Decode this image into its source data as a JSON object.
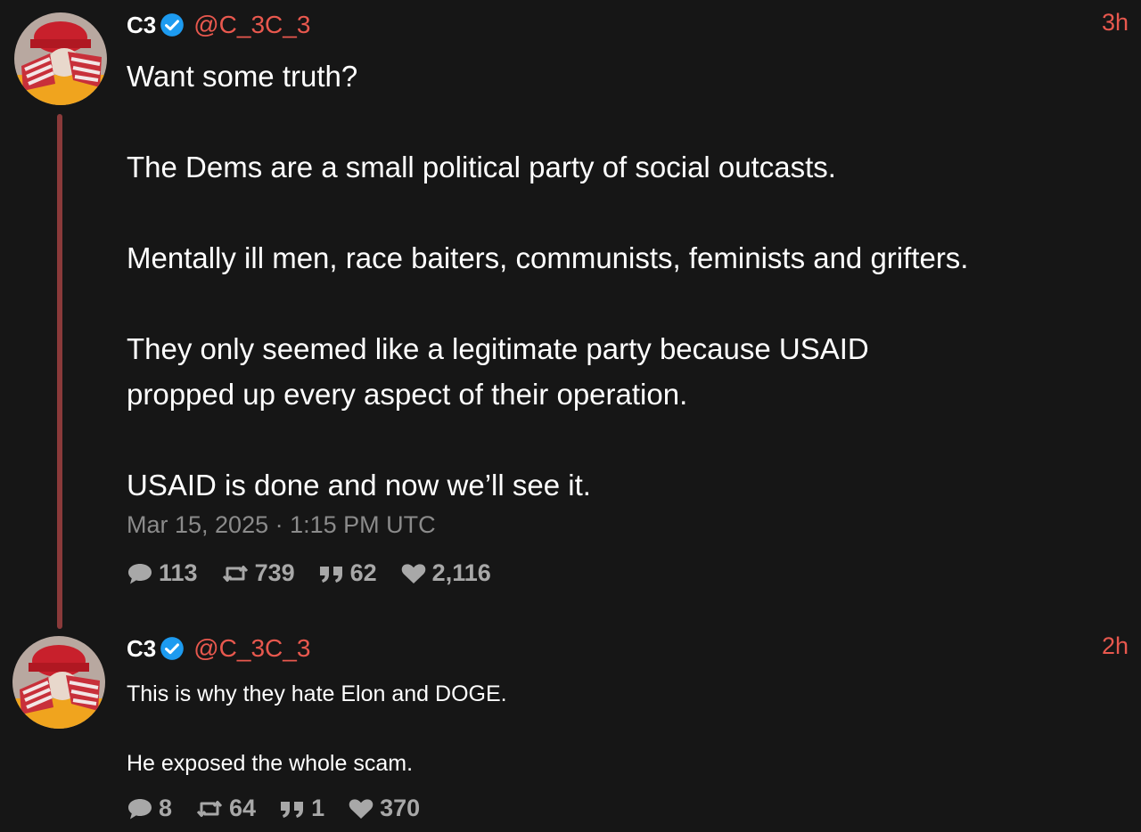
{
  "tweets": [
    {
      "fullname": "C3",
      "username": "@C_3C_3",
      "time": "3h",
      "paragraphs": [
        [
          "Want some truth?"
        ],
        [
          "The Dems are a small political party of social outcasts."
        ],
        [
          "Mentally ill men, race baiters, communists, feminists and grifters."
        ],
        [
          "They only seemed like a legitimate party because USAID",
          "propped up every aspect of their operation."
        ],
        [
          "USAID is done and now we’ll see it."
        ]
      ],
      "date": "Mar 15, 2025 · 1:15 PM UTC",
      "stats": {
        "replies": "113",
        "retweets": "739",
        "quotes": "62",
        "likes": "2,116"
      }
    },
    {
      "fullname": "C3",
      "username": "@C_3C_3",
      "time": "2h",
      "paragraphs": [
        [
          "This is why they hate Elon and DOGE."
        ],
        [
          "He exposed the whole scam."
        ]
      ],
      "stats": {
        "replies": "8",
        "retweets": "64",
        "quotes": "1",
        "likes": "370"
      }
    }
  ],
  "colors": {
    "background": "#161616",
    "accent": "#e8584e",
    "thread_line": "#8a3a3a",
    "verified": "#1d9bf0",
    "muted": "#8b8b8b"
  },
  "icons": [
    "verified-badge-icon",
    "reply-icon",
    "retweet-icon",
    "quote-icon",
    "heart-icon"
  ]
}
